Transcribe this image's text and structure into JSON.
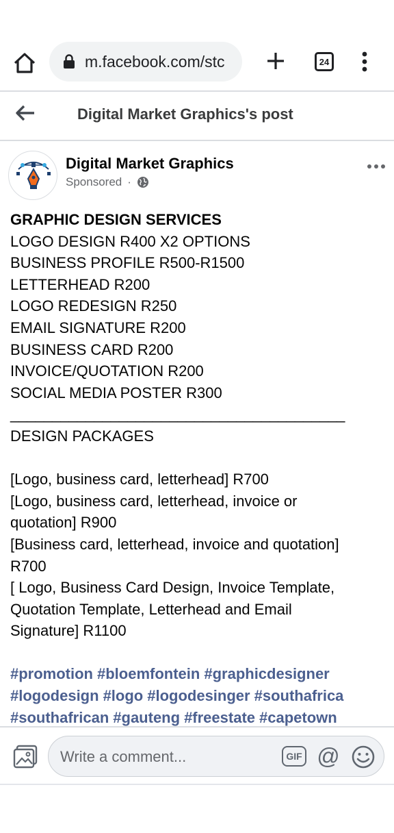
{
  "browser": {
    "url": "m.facebook.com/stc",
    "tab_count": "24"
  },
  "post_header": {
    "title": "Digital Market Graphics's post"
  },
  "post": {
    "page_name": "Digital Market Graphics",
    "sponsored_label": "Sponsored",
    "separator": "·",
    "lines": [
      {
        "text": "GRAPHIC DESIGN SERVICES",
        "bold": true
      },
      {
        "text": "LOGO DESIGN R400 X2 OPTIONS"
      },
      {
        "text": "BUSINESS PROFILE R500-R1500"
      },
      {
        "text": "LETTERHEAD R200"
      },
      {
        "text": "LOGO REDESIGN R250"
      },
      {
        "text": "EMAIL SIGNATURE R200"
      },
      {
        "text": "BUSINESS CARD R200"
      },
      {
        "text": "INVOICE/QUOTATION R200"
      },
      {
        "text": "SOCIAL MEDIA POSTER R300"
      },
      {
        "text": "________________________________________"
      },
      {
        "text": "DESIGN PACKAGES"
      },
      {
        "text": ""
      },
      {
        "text": "[Logo, business card, letterhead] R700"
      },
      {
        "text": "[Logo, business card, letterhead, invoice or"
      },
      {
        "text": "quotation] R900"
      },
      {
        "text": "[Business card, letterhead, invoice and quotation]"
      },
      {
        "text": "R700"
      },
      {
        "text": "[ Logo, Business Card Design, Invoice Template,"
      },
      {
        "text": "Quotation Template, Letterhead and Email"
      },
      {
        "text": "Signature] R1100"
      },
      {
        "text": ""
      }
    ],
    "hashtag_lines": [
      [
        "#promotion",
        "#bloemfontein",
        "#graphicdesigner"
      ],
      [
        "#logodesign",
        "#logo",
        "#logodesinger",
        "#southafrica"
      ],
      [
        "#southafrican",
        "#gauteng",
        "#freestate",
        "#capetown"
      ]
    ],
    "hashtag_color": "#4b5f8f"
  },
  "comment_bar": {
    "placeholder": "Write a comment...",
    "gif_label": "GIF",
    "at_symbol": "@"
  },
  "icons": [
    "home-icon",
    "lock-icon",
    "new-tab-icon",
    "tab-switcher-icon",
    "menu-icon",
    "back-arrow-icon",
    "globe-icon",
    "more-options-icon",
    "photo-icon",
    "gif-icon",
    "mention-icon",
    "emoji-icon"
  ]
}
